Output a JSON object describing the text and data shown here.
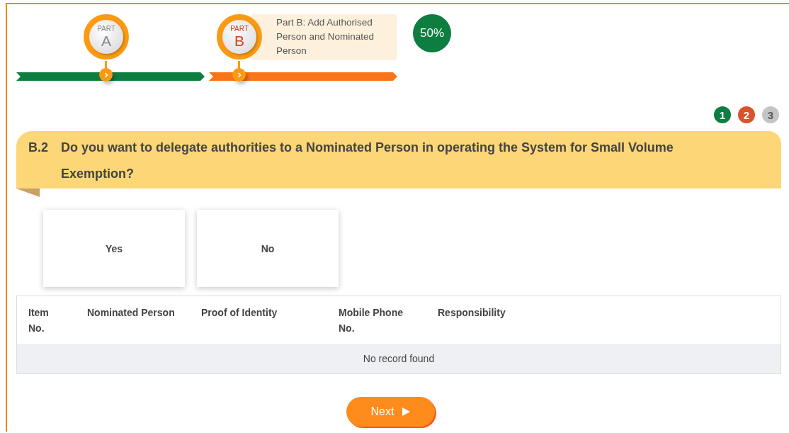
{
  "progress": {
    "parts": [
      {
        "prefix": "PART",
        "letter": "A",
        "completed": true,
        "current": false
      },
      {
        "prefix": "PART",
        "letter": "B",
        "completed": false,
        "current": true,
        "title": "Part B: Add Authorised Person and Nominated Person"
      }
    ],
    "percent": "50%"
  },
  "steps": [
    {
      "label": "1",
      "completed": true,
      "current": false
    },
    {
      "label": "2",
      "completed": false,
      "current": true
    },
    {
      "label": "3",
      "completed": false,
      "current": false
    }
  ],
  "question": {
    "number": "B.2",
    "text": "Do you want to delegate authorities to a Nominated Person in operating the System for Small Volume Exemption?"
  },
  "options": [
    {
      "label": "Yes",
      "selected": false
    },
    {
      "label": "No",
      "selected": false
    }
  ],
  "table": {
    "columns": [
      "Item No.",
      "Nominated Person",
      "Proof of Identity",
      "Mobile Phone No.",
      "Responsibility"
    ],
    "empty_message": "No record found"
  },
  "next_button": {
    "label": "Next"
  }
}
